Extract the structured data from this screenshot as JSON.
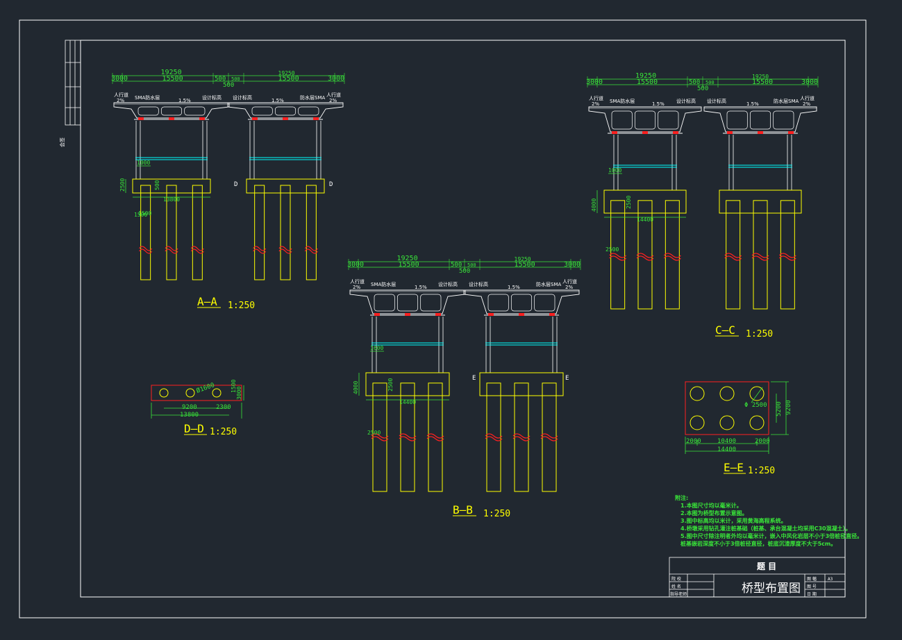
{
  "title_block": {
    "header": "题 目",
    "drawing_title": "桥型布置图",
    "left_rows": [
      "院 校",
      "姓 名",
      "指导老师"
    ],
    "right_rows": [
      "图 幅",
      "图 号",
      "日 期"
    ],
    "right_value": "A3"
  },
  "side_strip": {
    "label": "会签"
  },
  "sections": {
    "AA": {
      "name": "A—A",
      "scale": "1:250",
      "dims": {
        "total_left": "19250",
        "total_right": "19250",
        "sidewalk_left": "3000",
        "sidewalk_right": "3000",
        "carriage_left": "15500",
        "carriage_right": "15500",
        "median_a": "500",
        "median_b": "500",
        "median_total": "500",
        "beam_h": "1000",
        "cap_h": "2500",
        "cap_w": "13800",
        "col_gap": "1500",
        "pile_d": "1500",
        "col_w": "500"
      },
      "labels": {
        "walk_l": "人行道",
        "walk_r": "人行道",
        "slope": "2%",
        "pave_l": "SMA防水层",
        "pave_r": "防水层SMA",
        "cross": "1.5%",
        "elev_l": "设计标高",
        "elev_r": "设计标高",
        "cut_l": "D",
        "cut_r": "D"
      }
    },
    "BB": {
      "name": "B—B",
      "scale": "1:250",
      "dims": {
        "total_left": "19250",
        "total_right": "19250",
        "sidewalk_left": "3000",
        "sidewalk_right": "3000",
        "carriage_left": "15500",
        "carriage_right": "15500",
        "median_a": "500",
        "median_b": "500",
        "median_total": "500",
        "beam_h": "1600",
        "cap_h": "4000",
        "cap_w": "14400",
        "col_h": "2500",
        "pile_d": "2500"
      },
      "labels": {
        "walk_l": "人行道",
        "walk_r": "人行道",
        "slope": "2%",
        "pave_l": "SMA防水层",
        "pave_r": "防水层SMA",
        "cross": "1.5%",
        "elev_l": "设计标高",
        "elev_r": "设计标高",
        "cut_l": "E",
        "cut_r": "E"
      }
    },
    "CC": {
      "name": "C—C",
      "scale": "1:250",
      "dims": {
        "total_left": "19250",
        "total_right": "19250",
        "sidewalk_left": "3000",
        "sidewalk_right": "3000",
        "carriage_left": "15500",
        "carriage_right": "15500",
        "median_a": "500",
        "median_b": "500",
        "median_total": "500",
        "beam_h": "1000",
        "cap_h": "4000",
        "cap_w": "14400",
        "col_h": "2500",
        "pile_d": "2500"
      },
      "labels": {
        "walk_l": "人行道",
        "walk_r": "人行道",
        "slope": "2%",
        "pave_l": "SMA防水层",
        "pave_r": "防水层SMA",
        "cross": "1.5%",
        "elev_l": "设计标高",
        "elev_r": "设计标高"
      }
    },
    "DD": {
      "name": "D—D",
      "scale": "1:250",
      "dims": {
        "pile": "Ø1600",
        "spacing": "9200",
        "edge": "2300",
        "total": "13800",
        "h": "3000",
        "hb": "1500"
      }
    },
    "EE": {
      "name": "E—E",
      "scale": "1:250",
      "dims": {
        "pile": "Φ 2500",
        "row_sp": "5200",
        "total_h": "9200",
        "edge_l": "2000",
        "spacing": "10400",
        "edge_r": "2000",
        "total_w": "14400"
      }
    }
  },
  "notes": {
    "heading": "附注:",
    "lines": [
      "1.本图尺寸均以毫米计。",
      "2.本图为桥型布置示意图。",
      "3.图中标高均以米计，采用黄海高程系统。",
      "4.桥墩采用钻孔灌注桩基础（桩基、承台混凝土均采用C30混凝土）。",
      "5.图中尺寸除注明者外均以毫米计，嵌入中风化岩层不小于3倍桩径直径。",
      "  桩基嵌岩深度不小于3倍桩径直径，桩底沉渣厚度不大于5cm。"
    ]
  },
  "colors": {
    "bg": "#212830",
    "frame": "#ffffff",
    "structure": "#ffff00",
    "dimension": "#39e639",
    "cyan": "#00ffff",
    "red": "#ff2020"
  }
}
